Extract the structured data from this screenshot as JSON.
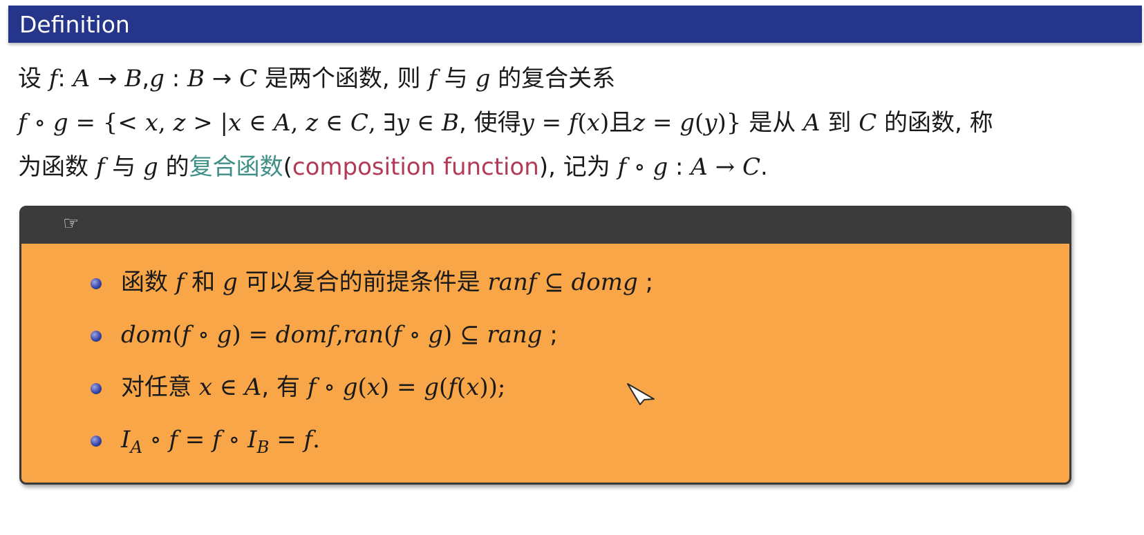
{
  "header": {
    "title": "Definition"
  },
  "definition": {
    "line1": [
      {
        "t": "设 "
      },
      {
        "t": "f",
        "m": 1
      },
      {
        "t": ": "
      },
      {
        "t": "A",
        "m": 1
      },
      {
        "t": " → "
      },
      {
        "t": "B",
        "m": 1
      },
      {
        "t": ","
      },
      {
        "t": "g",
        "m": 1
      },
      {
        "t": " : "
      },
      {
        "t": "B",
        "m": 1
      },
      {
        "t": " → "
      },
      {
        "t": "C",
        "m": 1
      },
      {
        "t": " 是两个函数, 则 "
      },
      {
        "t": "f",
        "m": 1
      },
      {
        "t": " 与 "
      },
      {
        "t": "g",
        "m": 1
      },
      {
        "t": " 的复合关系"
      }
    ],
    "line2": [
      {
        "t": "f",
        "m": 1
      },
      {
        "t": " ∘ ",
        "r": 1
      },
      {
        "t": "g",
        "m": 1
      },
      {
        "t": " = {< ",
        "r": 1
      },
      {
        "t": "x",
        "m": 1
      },
      {
        "t": ", ",
        "r": 1
      },
      {
        "t": "z",
        "m": 1
      },
      {
        "t": " > |",
        "r": 1
      },
      {
        "t": "x",
        "m": 1
      },
      {
        "t": " ∈ ",
        "r": 1
      },
      {
        "t": "A",
        "m": 1
      },
      {
        "t": ", ",
        "r": 1
      },
      {
        "t": "z",
        "m": 1
      },
      {
        "t": " ∈ ",
        "r": 1
      },
      {
        "t": "C",
        "m": 1
      },
      {
        "t": ", ∃",
        "r": 1
      },
      {
        "t": "y",
        "m": 1
      },
      {
        "t": " ∈ ",
        "r": 1
      },
      {
        "t": "B",
        "m": 1
      },
      {
        "t": ", 使得"
      },
      {
        "t": "y",
        "m": 1
      },
      {
        "t": " = ",
        "r": 1
      },
      {
        "t": "f",
        "m": 1
      },
      {
        "t": "(",
        "r": 1
      },
      {
        "t": "x",
        "m": 1
      },
      {
        "t": ")",
        "r": 1
      },
      {
        "t": "且"
      },
      {
        "t": "z",
        "m": 1
      },
      {
        "t": " = ",
        "r": 1
      },
      {
        "t": "g",
        "m": 1
      },
      {
        "t": "(",
        "r": 1
      },
      {
        "t": "y",
        "m": 1
      },
      {
        "t": ")}",
        "r": 1
      },
      {
        "t": " 是从 "
      },
      {
        "t": "A",
        "m": 1
      },
      {
        "t": " 到 "
      },
      {
        "t": "C",
        "m": 1
      },
      {
        "t": " 的函数, 称"
      }
    ],
    "line3": [
      {
        "t": "为函数 "
      },
      {
        "t": "f",
        "m": 1
      },
      {
        "t": " 与 "
      },
      {
        "t": "g",
        "m": 1
      },
      {
        "t": " 的"
      },
      {
        "t": "复合函数",
        "c": "teal"
      },
      {
        "t": "("
      },
      {
        "t": "composition function",
        "c": "red"
      },
      {
        "t": "), 记为 "
      },
      {
        "t": "f",
        "m": 1
      },
      {
        "t": " ∘ ",
        "r": 1
      },
      {
        "t": "g",
        "m": 1
      },
      {
        "t": " : "
      },
      {
        "t": "A",
        "m": 1
      },
      {
        "t": " → ",
        "r": 1
      },
      {
        "t": "C",
        "m": 1
      },
      {
        "t": "."
      }
    ]
  },
  "note_box": {
    "header_icon": "pointing-hand-icon",
    "header_glyph": "☞",
    "items": [
      [
        {
          "t": "函数 "
        },
        {
          "t": "f",
          "m": 1
        },
        {
          "t": " 和 "
        },
        {
          "t": "g",
          "m": 1
        },
        {
          "t": " 可以复合的前提条件是 "
        },
        {
          "t": "ranf",
          "m": 1
        },
        {
          "t": " ⊆ ",
          "r": 1
        },
        {
          "t": "domg",
          "m": 1
        },
        {
          "t": " ;"
        }
      ],
      [
        {
          "t": "dom",
          "m": 1
        },
        {
          "t": "(",
          "r": 1
        },
        {
          "t": "f",
          "m": 1
        },
        {
          "t": " ∘ ",
          "r": 1
        },
        {
          "t": "g",
          "m": 1
        },
        {
          "t": ") = ",
          "r": 1
        },
        {
          "t": "domf",
          "m": 1
        },
        {
          "t": ",",
          "r": 1
        },
        {
          "t": "ran",
          "m": 1
        },
        {
          "t": "(",
          "r": 1
        },
        {
          "t": "f",
          "m": 1
        },
        {
          "t": " ∘ ",
          "r": 1
        },
        {
          "t": "g",
          "m": 1
        },
        {
          "t": ") ⊆ ",
          "r": 1
        },
        {
          "t": "rang",
          "m": 1
        },
        {
          "t": " ;"
        }
      ],
      [
        {
          "t": "对任意 "
        },
        {
          "t": "x",
          "m": 1
        },
        {
          "t": " ∈ ",
          "r": 1
        },
        {
          "t": "A",
          "m": 1
        },
        {
          "t": ", 有 "
        },
        {
          "t": "f",
          "m": 1
        },
        {
          "t": " ∘ ",
          "r": 1
        },
        {
          "t": "g",
          "m": 1
        },
        {
          "t": "(",
          "r": 1
        },
        {
          "t": "x",
          "m": 1
        },
        {
          "t": ") = ",
          "r": 1
        },
        {
          "t": "g",
          "m": 1
        },
        {
          "t": "(",
          "r": 1
        },
        {
          "t": "f",
          "m": 1
        },
        {
          "t": "(",
          "r": 1
        },
        {
          "t": "x",
          "m": 1
        },
        {
          "t": "));",
          "r": 1
        }
      ],
      [
        {
          "t": "I",
          "m": 1
        },
        {
          "t": "A",
          "m": 1,
          "sub": 1
        },
        {
          "t": " ∘ ",
          "r": 1
        },
        {
          "t": "f",
          "m": 1
        },
        {
          "t": " = ",
          "r": 1
        },
        {
          "t": "f",
          "m": 1
        },
        {
          "t": " ∘ ",
          "r": 1
        },
        {
          "t": "I",
          "m": 1
        },
        {
          "t": "B",
          "m": 1,
          "sub": 1
        },
        {
          "t": " = ",
          "r": 1
        },
        {
          "t": "f",
          "m": 1
        },
        {
          "t": ".",
          "r": 1
        }
      ]
    ]
  },
  "colors": {
    "header_bg": "#25358a",
    "box_bg": "#f8a648",
    "box_header_bg": "#3b3b3b",
    "term_color": "#3f8f86",
    "english_color": "#b23a55"
  }
}
